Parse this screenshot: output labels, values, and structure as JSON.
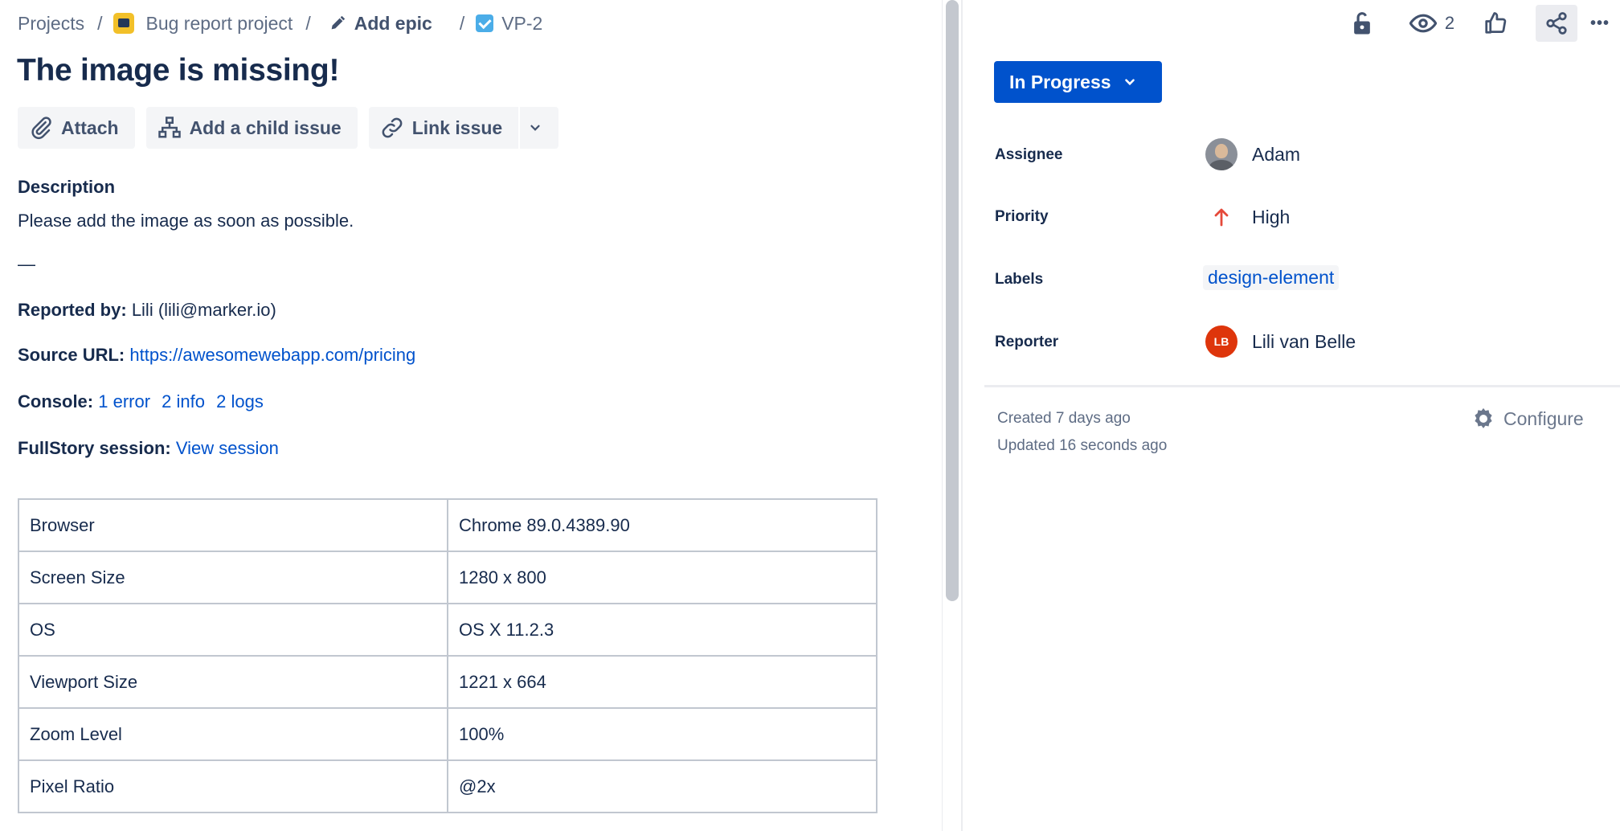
{
  "breadcrumb": {
    "projects": "Projects",
    "project": "Bug report project",
    "epic": "Add epic",
    "issue_key": "VP-2",
    "separator": "/"
  },
  "issue": {
    "title": "The image is missing!"
  },
  "actions": {
    "attach": "Attach",
    "add_child": "Add a child issue",
    "link_issue": "Link issue"
  },
  "description": {
    "label": "Description",
    "text": "Please add the image as soon as possible.",
    "dash": "—",
    "reported_by_label": "Reported by:",
    "reported_by_value": "Lili (lili@marker.io)",
    "source_url_label": "Source URL:",
    "source_url": "https://awesomewebapp.com/pricing",
    "console_label": "Console:",
    "console_error": "1 error",
    "console_info": "2 info",
    "console_logs": "2 logs",
    "fullstory_label": "FullStory session:",
    "fullstory_link": "View session"
  },
  "env_table": [
    {
      "key": "Browser",
      "value": "Chrome 89.0.4389.90"
    },
    {
      "key": "Screen Size",
      "value": "1280 x 800"
    },
    {
      "key": "OS",
      "value": "OS X 11.2.3"
    },
    {
      "key": "Viewport Size",
      "value": "1221 x 664"
    },
    {
      "key": "Zoom Level",
      "value": "100%"
    },
    {
      "key": "Pixel Ratio",
      "value": "@2x"
    }
  ],
  "toolbar": {
    "watchers_count": "2",
    "more": "•••"
  },
  "status": {
    "label": "In Progress"
  },
  "fields": {
    "assignee_label": "Assignee",
    "assignee_value": "Adam",
    "priority_label": "Priority",
    "priority_value": "High",
    "labels_label": "Labels",
    "labels_value": "design-element",
    "reporter_label": "Reporter",
    "reporter_value": "Lili van Belle",
    "reporter_initials": "LB"
  },
  "footer": {
    "created": "Created 7 days ago",
    "updated": "Updated 16 seconds ago",
    "configure": "Configure"
  },
  "colors": {
    "primary": "#0052cc",
    "priority_high": "#e5493a",
    "reporter_avatar": "#de350b",
    "project_icon": "#f2c029",
    "issue_type": "#4bade8"
  }
}
